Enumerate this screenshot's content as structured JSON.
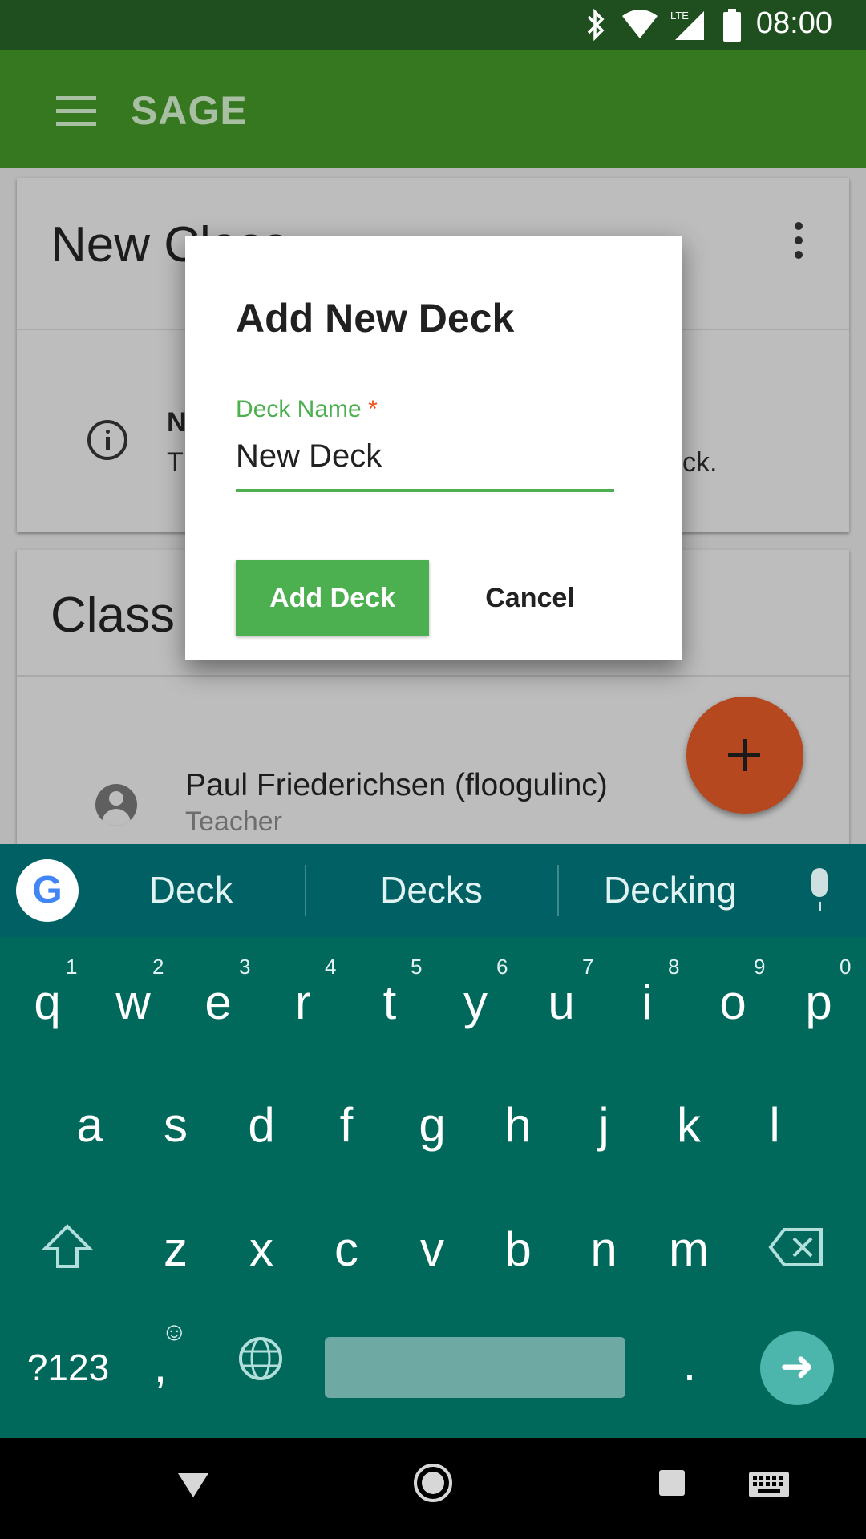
{
  "status_bar": {
    "time": "08:00",
    "network": "LTE"
  },
  "app_bar": {
    "title": "SAGE"
  },
  "card_class": {
    "title_partial": "New Class",
    "notice_bold_partial": "N",
    "notice_text_partial": "T",
    "notice_text_end": "ck."
  },
  "card_members": {
    "title_partial": "Class",
    "member_name": "Paul Friederichsen (floogulinc)",
    "member_role": "Teacher"
  },
  "dialog": {
    "title": "Add New Deck",
    "field_label": "Deck Name",
    "required_mark": "*",
    "field_value": "New Deck",
    "add_button": "Add Deck",
    "cancel_button": "Cancel"
  },
  "keyboard": {
    "suggestions": [
      "Deck",
      "Decks",
      "Decking"
    ],
    "row1": [
      "q",
      "w",
      "e",
      "r",
      "t",
      "y",
      "u",
      "i",
      "o",
      "p"
    ],
    "row1_hints": [
      "1",
      "2",
      "3",
      "4",
      "5",
      "6",
      "7",
      "8",
      "9",
      "0"
    ],
    "row2": [
      "a",
      "s",
      "d",
      "f",
      "g",
      "h",
      "j",
      "k",
      "l"
    ],
    "row3": [
      "z",
      "x",
      "c",
      "v",
      "b",
      "n",
      "m"
    ],
    "symbols_key": "?123",
    "comma_key": ",",
    "emoji_hint": "☺",
    "period_key": ".",
    "google_logo": "G"
  },
  "colors": {
    "app_bar": "#36781f",
    "accent": "#4caf50",
    "fab": "#b5481f",
    "keyboard": "#00695c"
  }
}
